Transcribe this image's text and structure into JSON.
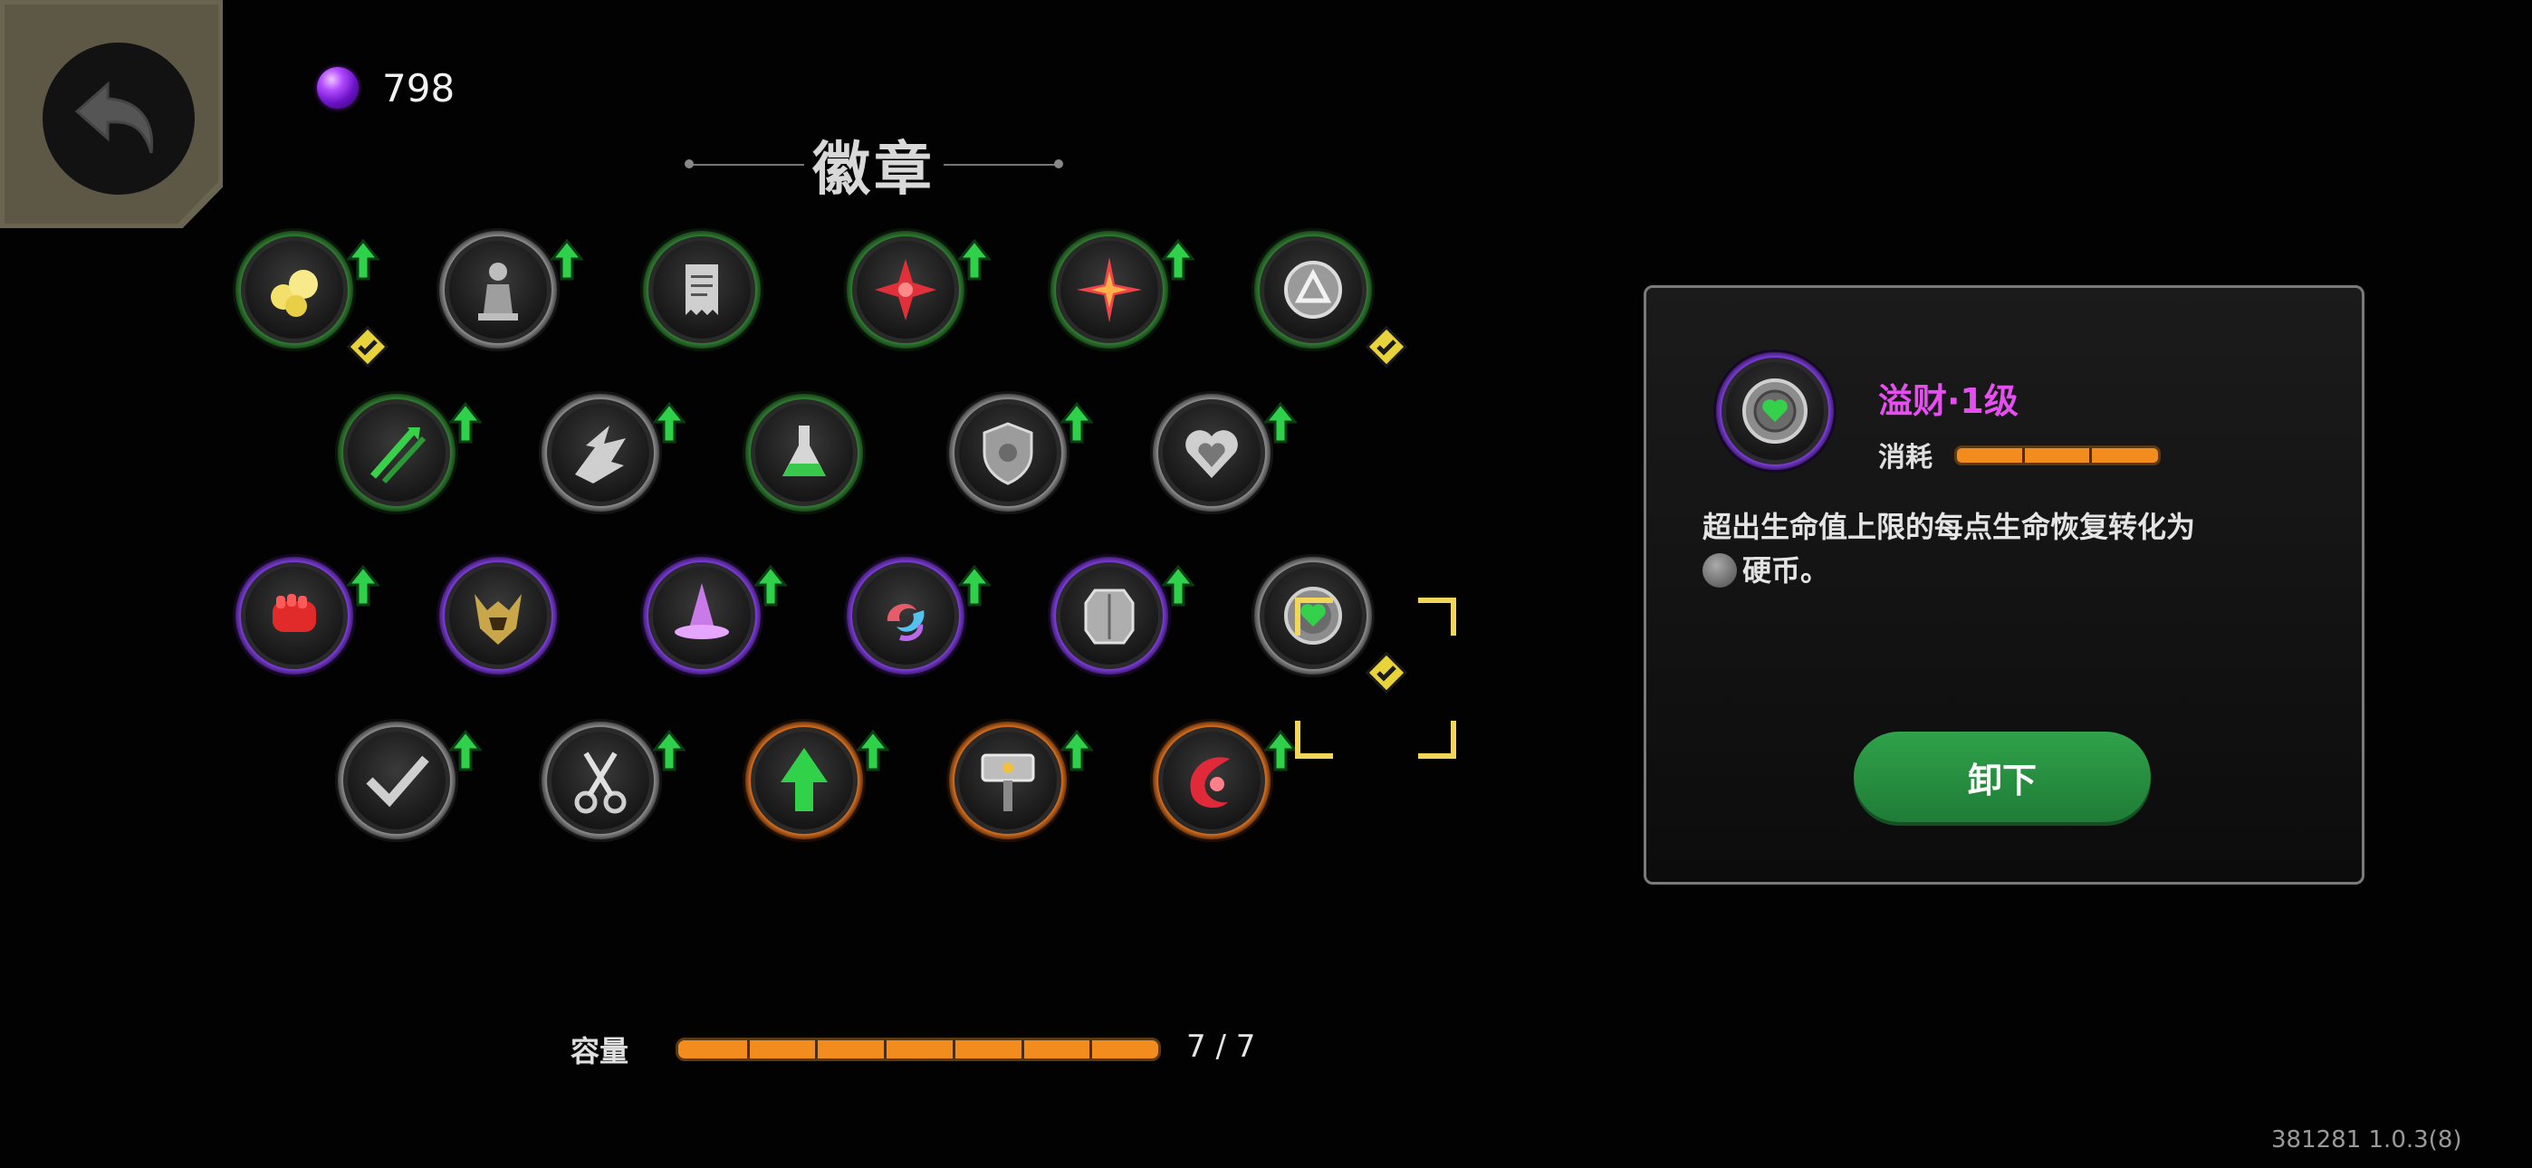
{
  "header": {
    "back_icon": "back-arrow-icon",
    "currency": {
      "icon": "purple-gem-icon",
      "value": "798"
    },
    "title": "徽章"
  },
  "badges": [
    {
      "id": "spirits",
      "icon": "yellow-spirits-icon",
      "rarity": "green",
      "upgradable": true,
      "equipped": true
    },
    {
      "id": "pawn",
      "icon": "pawn-icon",
      "rarity": "gray",
      "upgradable": true,
      "equipped": false
    },
    {
      "id": "receipt",
      "icon": "receipt-icon",
      "rarity": "green",
      "upgradable": false,
      "equipped": false
    },
    {
      "id": "red-star",
      "icon": "red-star-icon",
      "rarity": "green",
      "upgradable": true,
      "equipped": false
    },
    {
      "id": "red-spark",
      "icon": "red-spark-icon",
      "rarity": "green",
      "upgradable": true,
      "equipped": false
    },
    {
      "id": "triangle-coin",
      "icon": "triangle-coin-icon",
      "rarity": "green",
      "upgradable": false,
      "equipped": true
    },
    {
      "id": "green-arrows",
      "icon": "green-arrows-icon",
      "rarity": "green",
      "upgradable": true,
      "equipped": false
    },
    {
      "id": "impact",
      "icon": "impact-icon",
      "rarity": "gray",
      "upgradable": true,
      "equipped": false
    },
    {
      "id": "potion",
      "icon": "potion-icon",
      "rarity": "green",
      "upgradable": false,
      "equipped": false
    },
    {
      "id": "shield",
      "icon": "shield-icon",
      "rarity": "gray",
      "upgradable": true,
      "equipped": false
    },
    {
      "id": "heart",
      "icon": "heart-icon",
      "rarity": "gray",
      "upgradable": true,
      "equipped": false
    },
    {
      "id": "fist",
      "icon": "red-fist-icon",
      "rarity": "purple",
      "upgradable": true,
      "equipped": false
    },
    {
      "id": "helmet",
      "icon": "horned-helmet-icon",
      "rarity": "purple",
      "upgradable": false,
      "equipped": false
    },
    {
      "id": "witch-hat",
      "icon": "witch-hat-icon",
      "rarity": "purple",
      "upgradable": true,
      "equipped": false
    },
    {
      "id": "swirl",
      "icon": "swirl-icon",
      "rarity": "purple",
      "upgradable": true,
      "equipped": false
    },
    {
      "id": "armor",
      "icon": "armor-plate-icon",
      "rarity": "purple",
      "upgradable": true,
      "equipped": false
    },
    {
      "id": "heart-coin",
      "icon": "green-heart-coin-icon",
      "rarity": "gray",
      "upgradable": false,
      "equipped": true,
      "selected": true
    },
    {
      "id": "checkmark",
      "icon": "check-slash-icon",
      "rarity": "gray",
      "upgradable": true,
      "equipped": false
    },
    {
      "id": "scissors",
      "icon": "scissors-icon",
      "rarity": "gray",
      "upgradable": true,
      "equipped": false
    },
    {
      "id": "green-arrow",
      "icon": "green-arrow-up-icon",
      "rarity": "orange",
      "upgradable": true,
      "equipped": false
    },
    {
      "id": "hammer",
      "icon": "hammer-icon",
      "rarity": "orange",
      "upgradable": true,
      "equipped": false
    },
    {
      "id": "red-crescent",
      "icon": "red-crescent-icon",
      "rarity": "orange",
      "upgradable": true,
      "equipped": false
    }
  ],
  "detail": {
    "icon": "green-heart-coin-icon",
    "name": "溢财·1级",
    "cost_label": "消耗",
    "cost_segments": 3,
    "description_line1": "超出生命值上限的每点生命恢复转化为",
    "coin_icon": "coin-icon",
    "description_line2": "硬币。",
    "unequip_label": "卸下"
  },
  "capacity": {
    "label": "容量",
    "used": 7,
    "total": 7,
    "fill": 1.0,
    "value_text": "7 / 7"
  },
  "version": "381281 1.0.3(8)",
  "colors": {
    "green_ring": "#3c9a3c",
    "gray_ring": "#9a9a9a",
    "purple_ring": "#9b5cf0",
    "orange_ring": "#f08a2c",
    "selection": "#f1d65a",
    "name_magenta": "#e64ef2",
    "button_green": "#2fa24a",
    "bar_orange": "#f28c1e"
  }
}
